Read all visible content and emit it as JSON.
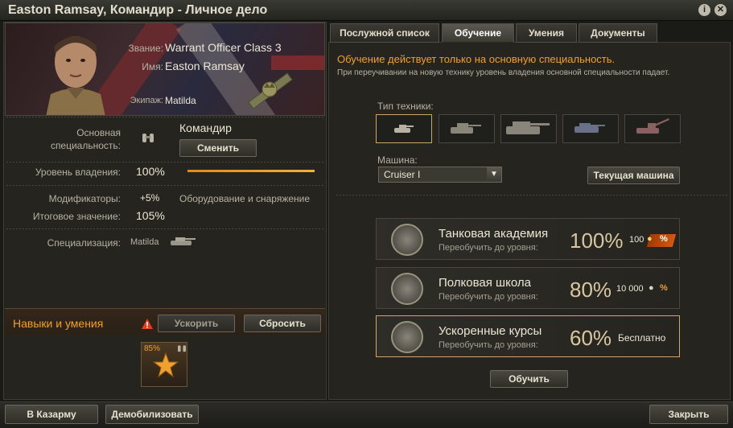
{
  "window": {
    "title": "Easton Ramsay, Командир - Личное дело",
    "info_icon": "info-icon",
    "close_icon": "close-icon"
  },
  "profile": {
    "rank_label": "Звание:",
    "rank_value": "Warrant Officer Class 3",
    "name_label": "Имя:",
    "name_value": "Easton Ramsay",
    "crew_label": "Экипаж:",
    "crew_value": "Matilda"
  },
  "specialty": {
    "label_line1": "Основная",
    "label_line2": "специальность:",
    "value": "Командир",
    "change_button": "Сменить",
    "proficiency_label": "Уровень владения:",
    "proficiency_value": "100%",
    "proficiency_fill": 1.0,
    "modifiers_label": "Модификаторы:",
    "modifiers_value": "+5%",
    "modifiers_desc": "Оборудование и снаряжение",
    "final_label": "Итоговое значение:",
    "final_value": "105%",
    "specialization_label": "Специализация:",
    "specialization_value": "Matilda"
  },
  "skills": {
    "title": "Навыки и умения",
    "accelerate_button": "Ускорить",
    "reset_button": "Сбросить",
    "skill_progress": "85%"
  },
  "tabs": [
    {
      "label": "Послужной список"
    },
    {
      "label": "Обучение"
    },
    {
      "label": "Умения"
    },
    {
      "label": "Документы"
    }
  ],
  "training": {
    "notice": "Обучение действует только на основную специальность.",
    "subnotice": "При переучивании на новую технику уровень владения основной специальности падает.",
    "vehicle_type_label": "Тип техники:",
    "vehicle_label": "Машина:",
    "vehicle_value": "Cruiser I",
    "current_vehicle_button": "Текущая машина",
    "retrain_button": "Обучить",
    "courses": [
      {
        "name": "Танковая академия",
        "sub": "Переобучить до уровня:",
        "pct": "100%",
        "price": "100"
      },
      {
        "name": "Полковая школа",
        "sub": "Переобучить до уровня:",
        "pct": "80%",
        "price": "10 000"
      },
      {
        "name": "Ускоренные курсы",
        "sub": "Переобучить до уровня:",
        "pct": "60%",
        "price": "Бесплатно"
      }
    ]
  },
  "footer": {
    "barracks_button": "В Казарму",
    "demobilize_button": "Демобилизовать",
    "close_button": "Закрыть"
  },
  "colors": {
    "accent": "#f0a030",
    "selected_border": "#c9a86a",
    "notice": "#f0a030"
  }
}
